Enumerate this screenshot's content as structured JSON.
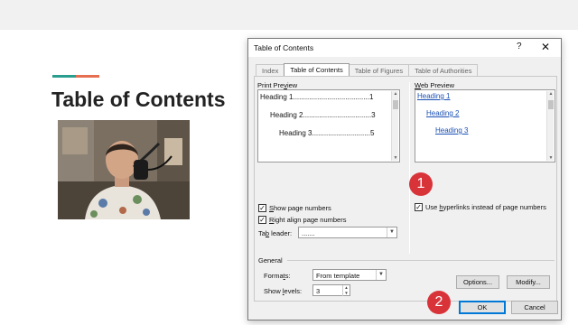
{
  "slide": {
    "title": "Table of Contents",
    "accent_colors": [
      "#2a9d8f",
      "#e76f51"
    ]
  },
  "dialog": {
    "title": "Table of Contents",
    "help_icon": "help-icon",
    "close_icon": "close-icon",
    "tabs": [
      {
        "label": "Index",
        "active": false
      },
      {
        "label": "Table of Contents",
        "active": true
      },
      {
        "label": "Table of Figures",
        "active": false
      },
      {
        "label": "Table of Authorities",
        "active": false
      }
    ],
    "print_preview": {
      "label_pre": "Print Pre",
      "label_u": "v",
      "label_post": "iew",
      "lines": [
        {
          "text": "Heading 1",
          "dots": "......................................",
          "page": "1"
        },
        {
          "text": "Heading 2",
          "dots": "..................................",
          "page": "3"
        },
        {
          "text": "Heading 3",
          "dots": ".............................",
          "page": "5"
        }
      ]
    },
    "web_preview": {
      "label_u": "W",
      "label_post": "eb Preview",
      "links": [
        "Heading 1",
        "Heading 2",
        "Heading 3"
      ]
    },
    "show_page_numbers": {
      "u": "S",
      "rest": "how page numbers",
      "checked": true
    },
    "right_align": {
      "u": "R",
      "rest": "ight align page numbers",
      "checked": true
    },
    "use_hyperlinks": {
      "pre": "Use ",
      "u": "h",
      "rest": "yperlinks instead of page numbers",
      "checked": true
    },
    "tab_leader": {
      "pre": "Ta",
      "u": "b",
      "rest": " leader:",
      "value": "......."
    },
    "general": {
      "label": "General",
      "formats_pre": "Forma",
      "formats_u": "t",
      "formats_post": "s:",
      "formats_value": "From template",
      "levels_pre": "Show ",
      "levels_u": "l",
      "levels_post": "evels:",
      "levels_value": "3"
    },
    "buttons": {
      "options": "Options...",
      "modify": "Modify...",
      "ok": "OK",
      "cancel": "Cancel"
    }
  },
  "callouts": [
    {
      "number": "1",
      "color": "#d9333a"
    },
    {
      "number": "2",
      "color": "#d9333a"
    }
  ]
}
